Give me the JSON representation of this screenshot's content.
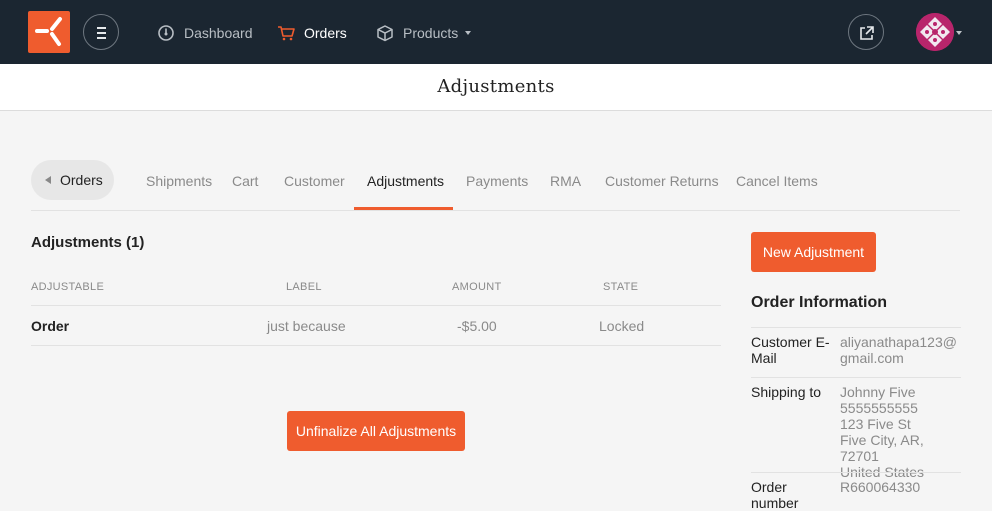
{
  "nav": {
    "items": [
      {
        "label": "Dashboard",
        "icon": "dashboard-icon"
      },
      {
        "label": "Orders",
        "icon": "cart-icon"
      },
      {
        "label": "Products",
        "icon": "box-icon"
      }
    ],
    "brand_color": "#ef5c2e",
    "bar_color": "#1b2631"
  },
  "page": {
    "title": "Adjustments"
  },
  "tabs": {
    "back_label": "Orders",
    "items": [
      "Shipments",
      "Cart",
      "Customer",
      "Adjustments",
      "Payments",
      "RMA",
      "Customer Returns",
      "Cancel Items"
    ],
    "active": "Adjustments"
  },
  "adjustments": {
    "title": "Adjustments (1)",
    "columns": [
      "ADJUSTABLE",
      "LABEL",
      "AMOUNT",
      "STATE"
    ],
    "rows": [
      {
        "adjustable": "Order",
        "label": "just because",
        "amount": "-$5.00",
        "state": "Locked"
      }
    ],
    "unfinalize_label": "Unfinalize All Adjustments"
  },
  "sidebar": {
    "new_adjustment_label": "New Adjustment",
    "title": "Order Information",
    "email_label": "Customer E-Mail",
    "email_value": "aliyanathapa123@gmail.com",
    "shipping_label": "Shipping to",
    "shipping_lines": [
      "Johnny Five",
      "5555555555",
      "123 Five St",
      "Five City, AR, 72701",
      "United States"
    ],
    "order_label": "Order number",
    "order_value": "R660064330"
  }
}
